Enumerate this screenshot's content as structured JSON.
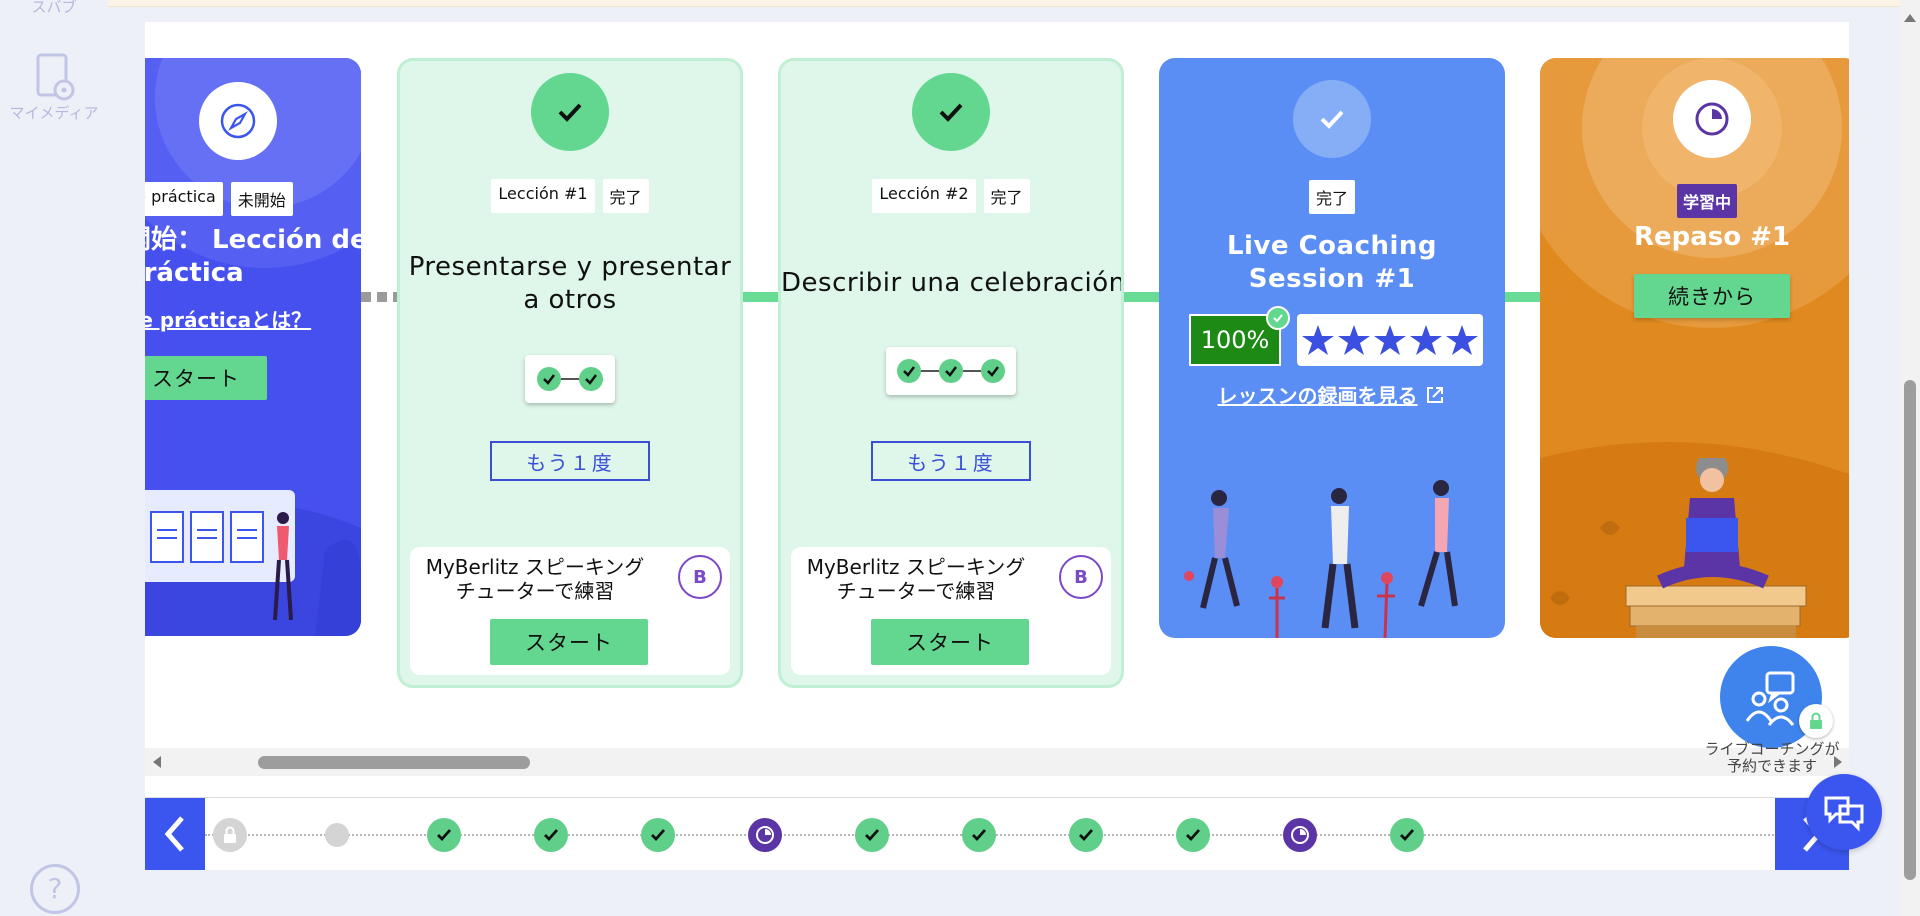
{
  "sidebar": {
    "items": [
      {
        "label": "スバブ"
      },
      {
        "label": "マイメディア"
      }
    ],
    "help_symbol": "?"
  },
  "cards": [
    {
      "id": "practice",
      "tag_type": "de práctica",
      "tag_status": "未開始",
      "title_line1": "開始： Lección de",
      "title_line2": "práctica",
      "link_prefix": "de práctica",
      "link_suffix": "とは？",
      "button": "スタート",
      "icon": "compass-icon"
    },
    {
      "id": "lesson1",
      "tag_type": "Lección #1",
      "tag_status": "完了",
      "title": "Presentarse y presentar a otros",
      "progress": "2 of 2 complete",
      "again": "もう１度",
      "tutor_text": "MyBerlitz スピーキングチューターで練習",
      "tutor_icon": "B",
      "tutor_button": "スタート"
    },
    {
      "id": "lesson2",
      "tag_type": "Lección #2",
      "tag_status": "完了",
      "title": "Describir una celebración",
      "progress": "3 of 3 complete",
      "again": "もう１度",
      "tutor_text": "MyBerlitz スピーキングチューターで練習",
      "tutor_icon": "B",
      "tutor_button": "スタート"
    },
    {
      "id": "coaching",
      "tag_status": "完了",
      "title": "Live Coaching Session #1",
      "score": "100%",
      "stars": 5,
      "link": "レッスンの録画を見る"
    },
    {
      "id": "review",
      "tag_status": "学習中",
      "title": "Repaso #1",
      "button": "続きから"
    }
  ],
  "timeline": [
    {
      "state": "locked"
    },
    {
      "state": "pending"
    },
    {
      "state": "done"
    },
    {
      "state": "done"
    },
    {
      "state": "done"
    },
    {
      "state": "in-progress"
    },
    {
      "state": "done"
    },
    {
      "state": "done"
    },
    {
      "state": "done"
    },
    {
      "state": "done"
    },
    {
      "state": "in-progress"
    },
    {
      "state": "done"
    }
  ],
  "floating": {
    "coach_caption": "ライブコーチングが予約できます"
  },
  "colors": {
    "primary_blue": "#3b56ef",
    "green": "#63d78f",
    "purple": "#5b34a6",
    "coaching_blue": "#5b8ef5",
    "review_orange": "#e0891f"
  }
}
